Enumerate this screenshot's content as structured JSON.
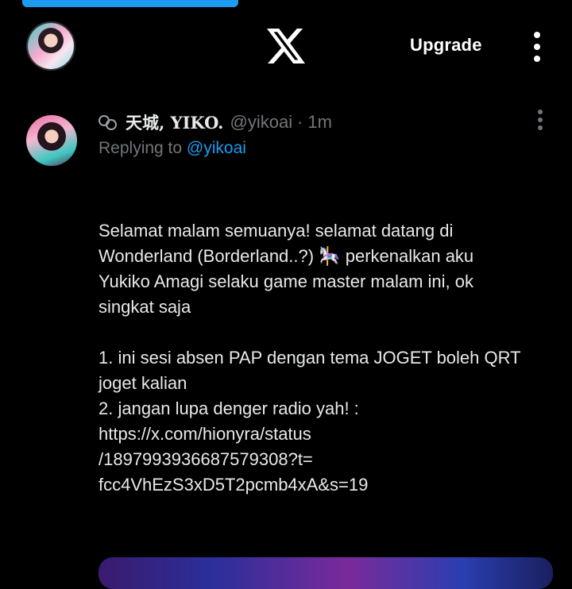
{
  "header": {
    "progress_fraction": 0.38,
    "logo": "x-logo-icon",
    "upgrade_label": "Upgrade",
    "more_icon": "vertical-ellipsis-icon"
  },
  "post": {
    "display_name": "天城, YIKO.",
    "handle": "@yikoai",
    "separator": "·",
    "time": "1m",
    "replying_prefix": "Replying to",
    "replying_to": "@yikoai",
    "body": {
      "p1_line1": "Selamat malam semuanya! selamat datang di",
      "p1_line2_a": "Wonderland (Borderland..?) ",
      "p1_emoji": "🎠",
      "p1_line2_b": " perkenalkan aku",
      "p1_line3": "Yukiko Amagi selaku game master malam ini, ok",
      "p1_line4": "singkat saja",
      "item1_line1": "1. ini sesi absen PAP dengan tema JOGET boleh QRT",
      "item1_line2": "joget kalian",
      "item2": "2. jangan lupa denger radio yah! :",
      "link_line1": "https://x.com/hionyra/status",
      "link_line2": "/1897993936687579308?t=",
      "link_line3": "fcc4VhEzS3xD5T2pcmb4xA&s=19"
    }
  },
  "colors": {
    "background": "#000000",
    "accent": "#1d9bf0",
    "text": "#e7e9ea",
    "muted": "#71767b"
  }
}
